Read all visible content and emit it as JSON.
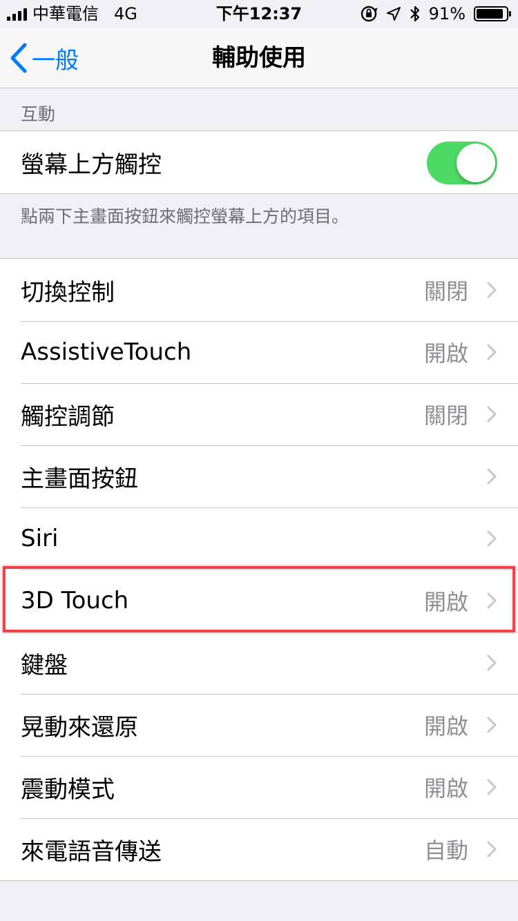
{
  "status_bar": {
    "carrier": "中華電信",
    "network": "4G",
    "time": "下午12:37",
    "battery_percent": "91%",
    "battery_level": 0.91
  },
  "nav": {
    "back_label": "一般",
    "title": "輔助使用"
  },
  "interaction_section": {
    "header": "互動",
    "reachability_label": "螢幕上方觸控",
    "reachability_on": true,
    "footer": "點兩下主畫面按鈕來觸控螢幕上方的項目。"
  },
  "settings": [
    {
      "label": "切換控制",
      "value": "關閉"
    },
    {
      "label": "AssistiveTouch",
      "value": "開啟"
    },
    {
      "label": "觸控調節",
      "value": "關閉"
    },
    {
      "label": "主畫面按鈕",
      "value": ""
    },
    {
      "label": "Siri",
      "value": ""
    },
    {
      "label": "3D Touch",
      "value": "開啟",
      "highlighted": true
    },
    {
      "label": "鍵盤",
      "value": ""
    },
    {
      "label": "晃動來還原",
      "value": "開啟"
    },
    {
      "label": "震動模式",
      "value": "開啟"
    },
    {
      "label": "來電語音傳送",
      "value": "自動"
    }
  ],
  "colors": {
    "accent": "#007aff",
    "toggle_on": "#4cd964",
    "highlight": "#f2424e",
    "secondary_text": "#8e8e93",
    "background": "#efeff4"
  }
}
